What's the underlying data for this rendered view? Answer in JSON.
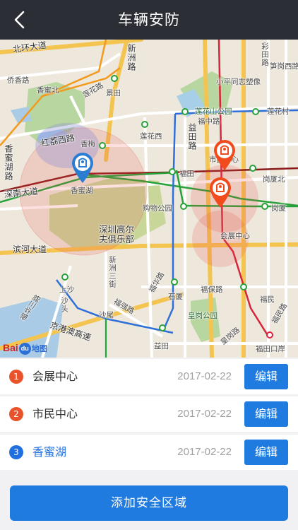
{
  "nav": {
    "title": "车辆安防",
    "back_icon": "chevron-left-icon"
  },
  "map": {
    "labels": {
      "beihuan": "北环大道",
      "xinzhou": "新洲路",
      "caitian": "彩田路",
      "sungang": "笋岗西路",
      "qiaoxiang": "侨香路",
      "xiangmibei": "香蜜北",
      "lianhualu": "莲花路",
      "jingtian": "景田",
      "xiaoping": "小平同志塑像",
      "lianhuashan": "莲花山公园",
      "lianhuacun": "莲花村",
      "hongli": "红荔西路",
      "xiangmei": "香梅",
      "lianhuaxi": "莲花西",
      "yitian": "益田路",
      "fuzhong": "福中路",
      "xiangmilu": "香蜜湖路",
      "shennan": "深南大道",
      "xiangmihu": "香蜜湖",
      "futian": "福田",
      "gangxiabei": "岗厦北",
      "shimin": "市民中心",
      "gouwu": "购物公园",
      "gangxia": "岗厦",
      "golf": "深圳高尔夫俱乐部",
      "huizhan": "会展中心",
      "binhe": "滨河大道",
      "xinzhou3": "新洲三街",
      "fuhua": "福华路",
      "shangsha": "上沙",
      "shixia": "石厦",
      "fubao": "福保路",
      "fumin": "福民",
      "fuminlu": "福民路",
      "fuhua3": "福华三路",
      "fuqiang": "福强路",
      "shatou": "沙头",
      "shawei": "沙尾",
      "huanggang": "皇岗公园",
      "yitianzhan": "益田",
      "futiankouan": "福田口岸",
      "jinggang": "京港澳高速",
      "huanggangguo": "皇岗路"
    },
    "logo": {
      "bai": "Bai",
      "du": "du",
      "tu": "地图"
    }
  },
  "zones": [
    {
      "index": "1",
      "name": "会展中心",
      "date": "2017-02-22",
      "edit_label": "编辑",
      "color": "#e8532b",
      "name_color": "#333333"
    },
    {
      "index": "2",
      "name": "市民中心",
      "date": "2017-02-22",
      "edit_label": "编辑",
      "color": "#e8532b",
      "name_color": "#333333"
    },
    {
      "index": "3",
      "name": "香蜜湖",
      "date": "2017-02-22",
      "edit_label": "编辑",
      "color": "#1f6fe0",
      "name_color": "#1f6fe0"
    }
  ],
  "add_button": {
    "label": "添加安全区域"
  },
  "colors": {
    "accent": "#1f7be0",
    "navbar": "#2b2e35",
    "active_pin": "#2b7dd4",
    "alert_pin": "#f04a1d"
  }
}
